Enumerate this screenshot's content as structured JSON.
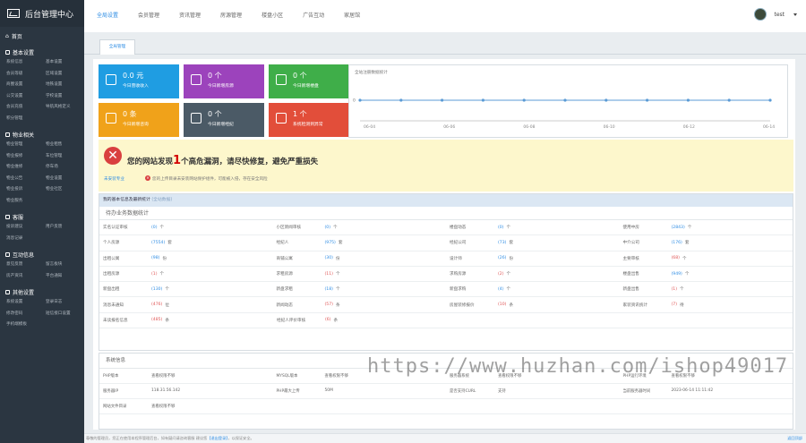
{
  "app": {
    "title": "后台管理中心"
  },
  "topbar": {
    "tabs": [
      "全局设置",
      "会员管理",
      "资讯管理",
      "房源管理",
      "楼盘小区",
      "广告互动",
      "家居馆"
    ],
    "active": 0,
    "user": "test"
  },
  "subtab": "全局管理",
  "sidebar": {
    "home": "首页",
    "sections": [
      {
        "title": "基本设置",
        "items": [
          "系统信息",
          "基本设置",
          "会员等级",
          "区域设置",
          "商圈设置",
          "地铁设置",
          "公交设置",
          "学校设置",
          "会员充值",
          "导航风格定义",
          "积分管理"
        ]
      },
      {
        "title": "物业相关",
        "items": [
          "物业管理",
          "物业租售",
          "物业报修",
          "车位管理",
          "物业维修",
          "停车场",
          "物业公告",
          "物业设置",
          "物业投诉",
          "物业社区",
          "物业服务"
        ]
      },
      {
        "title": "客服",
        "items": [
          "投诉建议",
          "用户反馈",
          "消息记录"
        ]
      },
      {
        "title": "互动信息",
        "items": [
          "意见反馈",
          "留言板块",
          "房产资讯",
          "平台通知"
        ]
      },
      {
        "title": "其他设置",
        "items": [
          "系统设置",
          "登录日志",
          "修改密码",
          "短信接口设置",
          "手机端模板"
        ]
      }
    ]
  },
  "cards": [
    {
      "num": "0.0 元",
      "label": "今日营收收入",
      "color": "#1f9de2"
    },
    {
      "num": "0 个",
      "label": "今日新增房源",
      "color": "#9c43bc"
    },
    {
      "num": "0 个",
      "label": "今日新增楼盘",
      "color": "#3fae49"
    },
    {
      "num": "0 条",
      "label": "今日新增咨询",
      "color": "#f0a21a"
    },
    {
      "num": "0 个",
      "label": "今日新增经纪",
      "color": "#4b5a66"
    },
    {
      "num": "1 个",
      "label": "系统检测到异常",
      "color": "#e24e3a"
    }
  ],
  "chart_data": {
    "type": "line",
    "title": "全站注册数据统计",
    "categories": [
      "06-04",
      "06-06",
      "06-08",
      "06-10",
      "06-12",
      "06-14"
    ],
    "values": [
      0,
      0,
      0,
      0,
      0,
      0,
      0,
      0,
      0,
      0,
      0
    ],
    "ylabels": [
      "0"
    ],
    "color": "#5b9bd5"
  },
  "alert": {
    "title_pre": "您的网站发现",
    "count": "1",
    "title_post": "个高危漏洞，请尽快修复，避免严重损失",
    "line1": "未安装专业",
    "line2": "您的上传目录未安装网站保护组件，可能被入侵，存在安全风险"
  },
  "stats": {
    "header": "我的基本信息及最新统计",
    "header_sub": "(全站数据)",
    "subtitle": "待办业务数据统计",
    "rows": [
      [
        {
          "k": "实名认证审核",
          "v": "(0)",
          "u": "个"
        },
        {
          "k": "小区新闻审核",
          "v": "(0)",
          "u": "个"
        },
        {
          "k": "楼盘动态",
          "v": "(0)",
          "u": "个"
        },
        {
          "k": "使用中房",
          "v": "(2843)",
          "u": "个"
        }
      ],
      [
        {
          "k": "个人房源",
          "v": "(7554)",
          "u": "套"
        },
        {
          "k": "经纪人",
          "v": "(975)",
          "u": "套"
        },
        {
          "k": "经纪公司",
          "v": "(73)",
          "u": "套"
        },
        {
          "k": "中介公司",
          "v": "(176)",
          "u": "套"
        }
      ],
      [
        {
          "k": "出租公寓",
          "v": "(98)",
          "u": "份"
        },
        {
          "k": "商铺公寓",
          "v": "(30)",
          "u": "份"
        },
        {
          "k": "设计师",
          "v": "(26)",
          "u": "份"
        },
        {
          "k": "主要审核",
          "v": "(68)",
          "u": "个",
          "red": true
        }
      ],
      [
        {
          "k": "出租房源",
          "v": "(1)",
          "u": "个",
          "red": true
        },
        {
          "k": "求租房源",
          "v": "(11)",
          "u": "个",
          "red": true
        },
        {
          "k": "求购房源",
          "v": "(2)",
          "u": "个",
          "red": true
        },
        {
          "k": "楼盘出售",
          "v": "(949)",
          "u": "个"
        }
      ],
      [
        {
          "k": "新盘出租",
          "v": "(130)",
          "u": "个"
        },
        {
          "k": "新盘求租",
          "v": "(18)",
          "u": "个"
        },
        {
          "k": "新盘求购",
          "v": "(4)",
          "u": "个"
        },
        {
          "k": "新盘出售",
          "v": "(1)",
          "u": "个",
          "red": true
        }
      ],
      [
        {
          "k": "消息未通知",
          "v": "(476)",
          "u": "位",
          "red": true
        },
        {
          "k": "新闻动态",
          "v": "(57)",
          "u": "条",
          "red": true
        },
        {
          "k": "房屋装修报价",
          "v": "(10)",
          "u": "条",
          "red": true
        },
        {
          "k": "家装资讯统计",
          "v": "(7)",
          "u": "待",
          "red": true
        }
      ],
      [
        {
          "k": "未读报名信息",
          "v": "(485)",
          "u": "条",
          "red": true
        },
        {
          "k": "经纪人评价审核",
          "v": "(6)",
          "u": "条",
          "red": true
        }
      ]
    ]
  },
  "sys": {
    "header": "系统信息",
    "rows": [
      [
        {
          "k": "PHP版本",
          "v": "查看权限不够"
        },
        {
          "k": "MYSQL版本",
          "v": "查看权限不够"
        },
        {
          "k": "服务器系统",
          "v": "查看权限不够"
        },
        {
          "k": "PHP运行环境",
          "v": "查看权限不够"
        }
      ],
      [
        {
          "k": "服务器IP",
          "v": "118.31.56.142"
        },
        {
          "k": "PHP最大上传",
          "v": "50M"
        },
        {
          "k": "是否支持CURL",
          "v": "支持"
        },
        {
          "k": "当前服务器时间",
          "v": "2023-06-14 11:11:42"
        }
      ],
      [
        {
          "k": "网站文件目录",
          "v": "查看权限不够"
        }
      ]
    ]
  },
  "watermark": "https://www.huzhan.com/ishop49017",
  "footer": {
    "text": "尊敬的管理员，您正在使用本程序管理后台，如有疑问请咨询客服 建议您",
    "link": "【退出登录】",
    "tail": "，以保证安全。",
    "right": "返回顶部"
  }
}
